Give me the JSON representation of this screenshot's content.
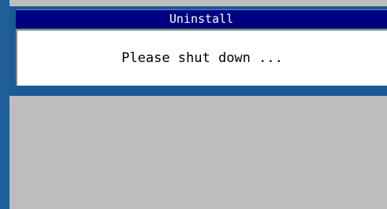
{
  "dialog": {
    "title": "Uninstall",
    "message": "Please shut down ..."
  },
  "colors": {
    "titlebar": "#000080",
    "frame": "#1b5a93",
    "desktop": "#bdbdbd",
    "panel": "#ffffff"
  }
}
